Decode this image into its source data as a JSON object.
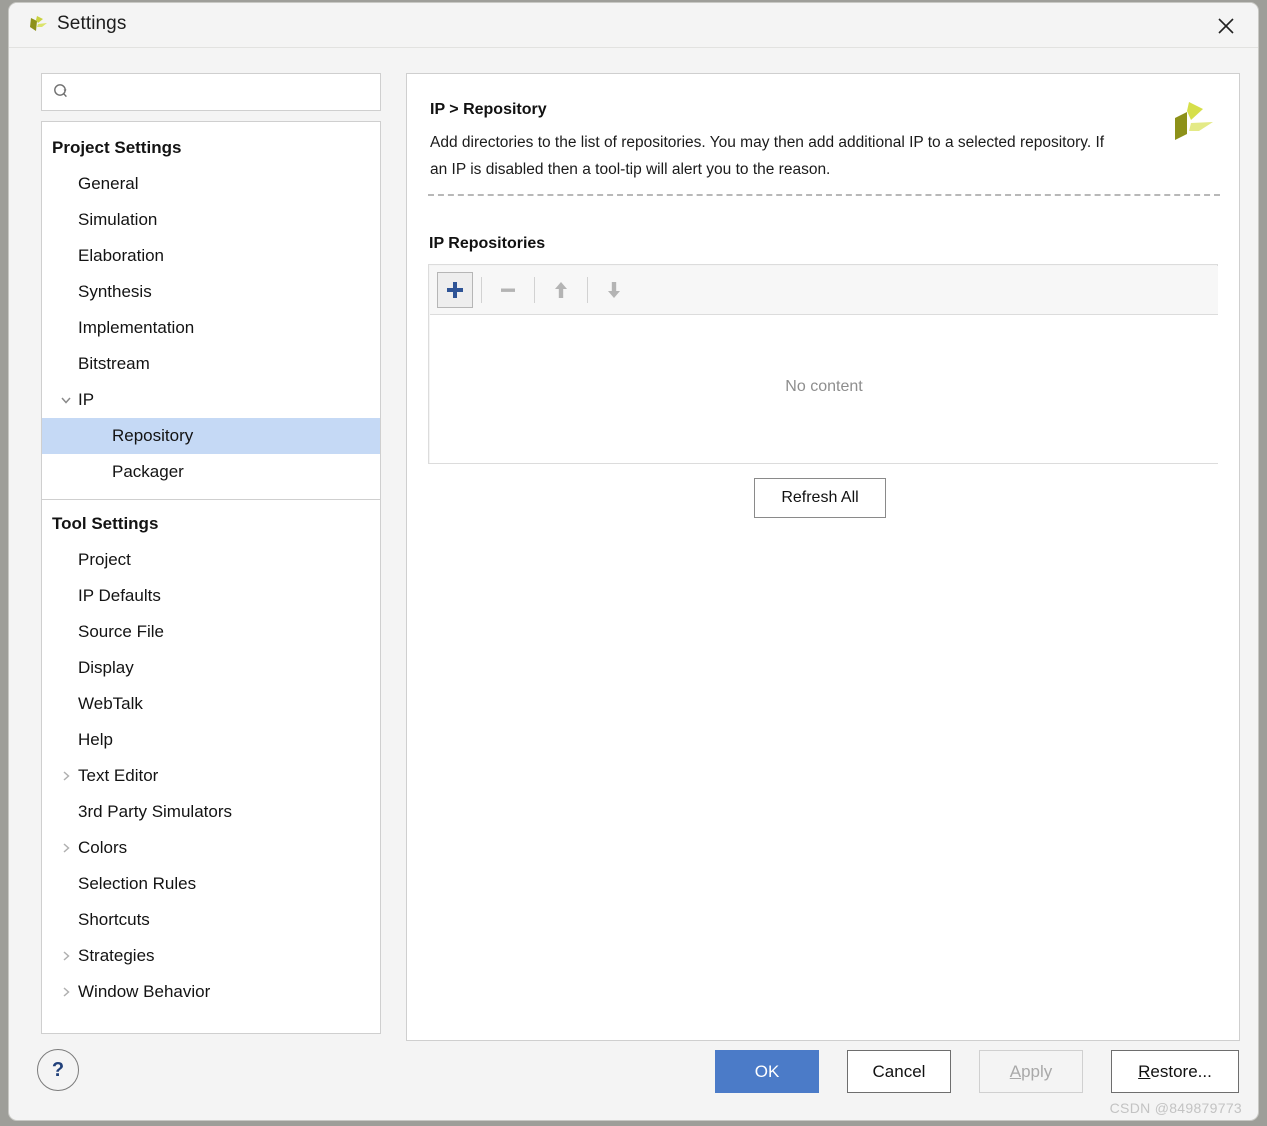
{
  "window": {
    "title": "Settings",
    "logo_icon": "vivado-logo-icon",
    "close_icon": "close-icon"
  },
  "search": {
    "placeholder": "",
    "value": "",
    "icon": "search-icon"
  },
  "sidebar": {
    "groups": [
      {
        "label": "Project Settings",
        "items": [
          {
            "label": "General",
            "level": 1,
            "expandable": false,
            "expanded": false,
            "selected": false
          },
          {
            "label": "Simulation",
            "level": 1,
            "expandable": false,
            "expanded": false,
            "selected": false
          },
          {
            "label": "Elaboration",
            "level": 1,
            "expandable": false,
            "expanded": false,
            "selected": false
          },
          {
            "label": "Synthesis",
            "level": 1,
            "expandable": false,
            "expanded": false,
            "selected": false
          },
          {
            "label": "Implementation",
            "level": 1,
            "expandable": false,
            "expanded": false,
            "selected": false
          },
          {
            "label": "Bitstream",
            "level": 1,
            "expandable": false,
            "expanded": false,
            "selected": false
          },
          {
            "label": "IP",
            "level": 1,
            "expandable": true,
            "expanded": true,
            "selected": false
          },
          {
            "label": "Repository",
            "level": 2,
            "expandable": false,
            "expanded": false,
            "selected": true
          },
          {
            "label": "Packager",
            "level": 2,
            "expandable": false,
            "expanded": false,
            "selected": false
          }
        ]
      },
      {
        "label": "Tool Settings",
        "items": [
          {
            "label": "Project",
            "level": 1,
            "expandable": false,
            "expanded": false,
            "selected": false
          },
          {
            "label": "IP Defaults",
            "level": 1,
            "expandable": false,
            "expanded": false,
            "selected": false
          },
          {
            "label": "Source File",
            "level": 1,
            "expandable": false,
            "expanded": false,
            "selected": false
          },
          {
            "label": "Display",
            "level": 1,
            "expandable": false,
            "expanded": false,
            "selected": false
          },
          {
            "label": "WebTalk",
            "level": 1,
            "expandable": false,
            "expanded": false,
            "selected": false
          },
          {
            "label": "Help",
            "level": 1,
            "expandable": false,
            "expanded": false,
            "selected": false
          },
          {
            "label": "Text Editor",
            "level": 1,
            "expandable": true,
            "expanded": false,
            "selected": false
          },
          {
            "label": "3rd Party Simulators",
            "level": 1,
            "expandable": false,
            "expanded": false,
            "selected": false
          },
          {
            "label": "Colors",
            "level": 1,
            "expandable": true,
            "expanded": false,
            "selected": false
          },
          {
            "label": "Selection Rules",
            "level": 1,
            "expandable": false,
            "expanded": false,
            "selected": false
          },
          {
            "label": "Shortcuts",
            "level": 1,
            "expandable": false,
            "expanded": false,
            "selected": false
          },
          {
            "label": "Strategies",
            "level": 1,
            "expandable": true,
            "expanded": false,
            "selected": false
          },
          {
            "label": "Window Behavior",
            "level": 1,
            "expandable": true,
            "expanded": false,
            "selected": false
          }
        ]
      }
    ]
  },
  "content": {
    "breadcrumb_title": "IP > Repository",
    "description": "Add directories to the list of repositories. You may then add additional IP to a selected repository. If an IP is disabled then a tool-tip will alert you to the reason.",
    "brand_logo_icon": "xilinx-logo-icon",
    "section_label": "IP Repositories",
    "toolbar": [
      {
        "name": "add-repository-button",
        "icon": "plus-icon",
        "enabled": true
      },
      {
        "name": "remove-repository-button",
        "icon": "minus-icon",
        "enabled": false
      },
      {
        "name": "move-up-button",
        "icon": "arrow-up-icon",
        "enabled": false
      },
      {
        "name": "move-down-button",
        "icon": "arrow-down-icon",
        "enabled": false
      }
    ],
    "list_empty_text": "No content",
    "list_rows": [],
    "refresh_label": "Refresh All"
  },
  "footer": {
    "help_label": "?",
    "ok_label": "OK",
    "cancel_label": "Cancel",
    "apply_label": "Apply",
    "apply_mnemonic": "A",
    "apply_rest": "pply",
    "restore_mnemonic": "R",
    "restore_rest": "estore...",
    "apply_enabled": false
  },
  "watermark": "CSDN @849879773",
  "colors": {
    "accent_blue": "#4b7bc8",
    "selection_blue": "#c5d9f5",
    "plus_blue": "#2f5496",
    "disabled_gray": "#b4b4b4",
    "brand_yellow": "#d6df4a",
    "brand_olive": "#8d9119"
  }
}
